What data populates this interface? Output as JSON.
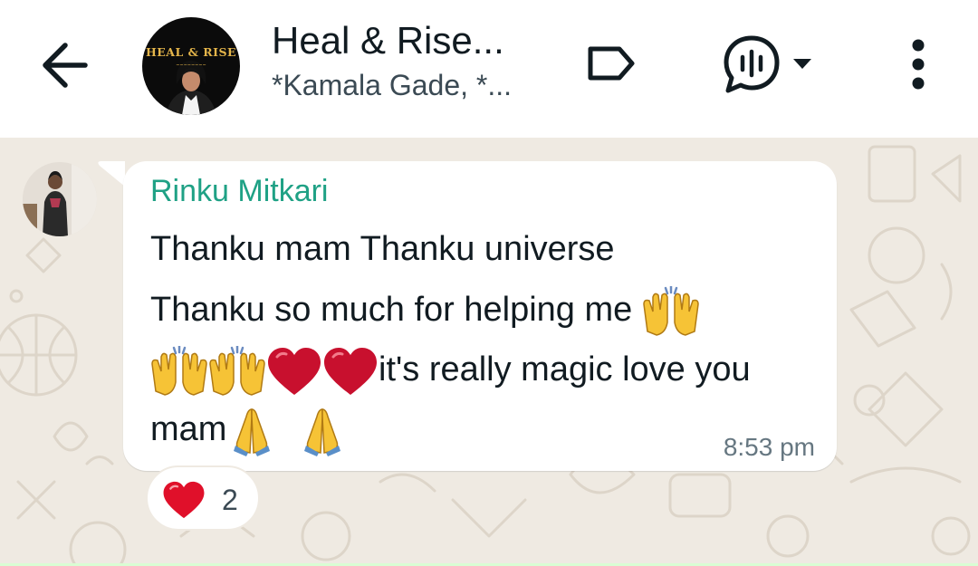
{
  "header": {
    "title": "Heal & Rise...",
    "subtitle": "*Kamala Gade, *...",
    "avatar_brand_text": "HEAL & RISE",
    "icons": {
      "back": "arrow-left-icon",
      "label": "label-tag-icon",
      "call": "voice-chat-icon",
      "dropdown": "caret-down-icon",
      "menu": "more-vertical-icon"
    }
  },
  "message": {
    "sender": "Rinku Mitkari",
    "sender_color": "#1fa185",
    "line1": "Thanku mam Thanku universe",
    "line2": "Thanku so much for helping me",
    "line3": "it's really magic love you",
    "line4": "mam",
    "time": "8:53 pm",
    "emojis": [
      "raised-hands",
      "raised-hands",
      "raised-hands",
      "red-heart",
      "red-heart",
      "folded-hands",
      "folded-hands"
    ]
  },
  "reaction": {
    "emoji": "red-heart",
    "count": "2"
  },
  "colors": {
    "chat_background": "#efeae2",
    "bubble": "#ffffff",
    "timestamp": "#667781",
    "icon": "#111b21"
  }
}
